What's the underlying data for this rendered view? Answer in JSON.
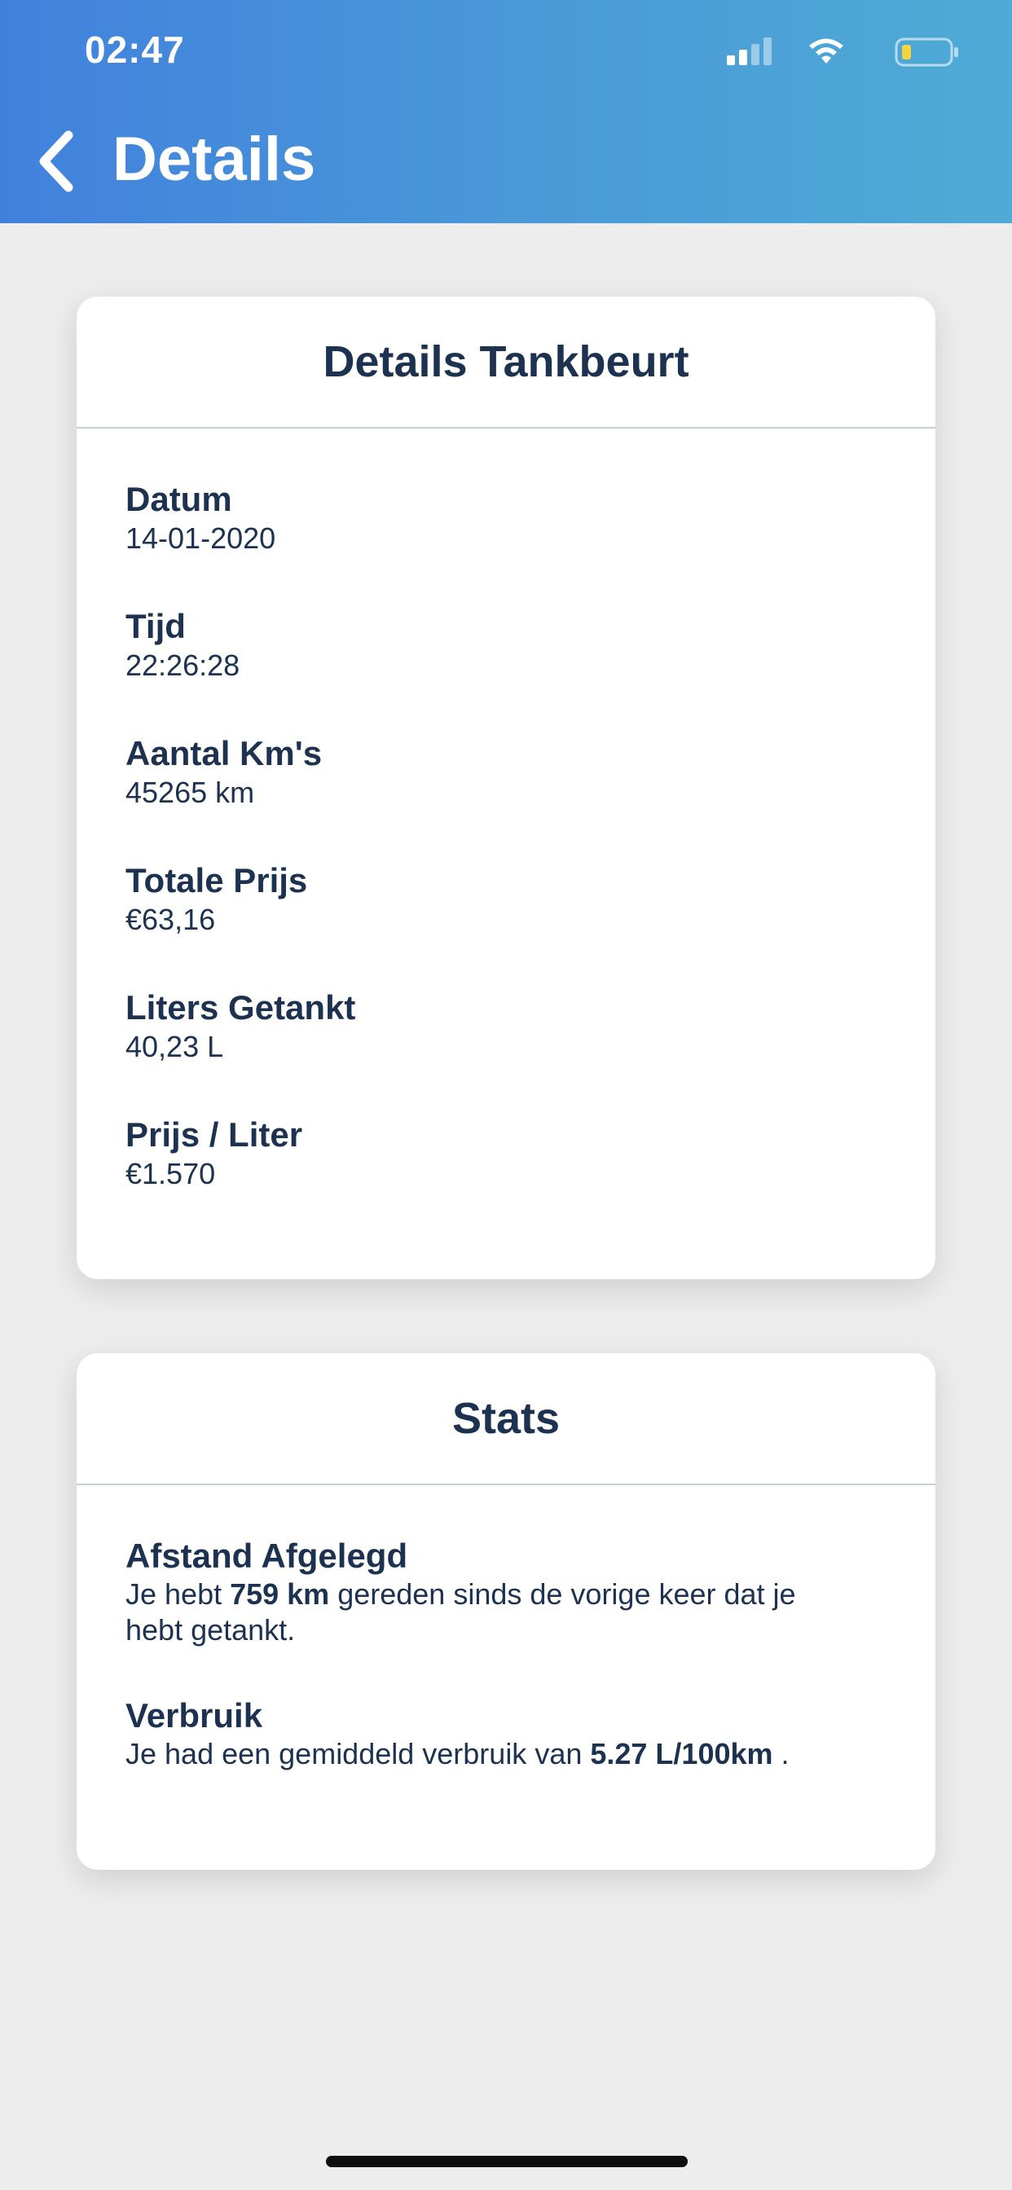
{
  "status_bar": {
    "time": "02:47",
    "icons": [
      "signal-icon",
      "wifi-icon",
      "battery-icon"
    ],
    "battery_color": "#f2d43c"
  },
  "nav": {
    "back_icon": "chevron-left-icon",
    "title": "Details"
  },
  "colors": {
    "header_gradient_start": "#4181dd",
    "header_gradient_end": "#4fabd6",
    "text_dark": "#1c3250",
    "background": "#ededed"
  },
  "details_card": {
    "title": "Details Tankbeurt",
    "fields": [
      {
        "label": "Datum",
        "value": "14-01-2020"
      },
      {
        "label": "Tijd",
        "value": "22:26:28"
      },
      {
        "label": "Aantal Km's",
        "value": "45265 km"
      },
      {
        "label": "Totale Prijs",
        "value": "€63,16"
      },
      {
        "label": "Liters Getankt",
        "value": "40,23 L"
      },
      {
        "label": "Prijs / Liter",
        "value": "€1.570"
      }
    ]
  },
  "stats_card": {
    "title": "Stats",
    "distance": {
      "label": "Afstand Afgelegd",
      "text_before": "Je hebt ",
      "highlight": "759 km",
      "text_after": " gereden sinds de vorige keer dat je hebt getankt."
    },
    "consumption": {
      "label": "Verbruik",
      "text_before": "Je had een gemiddeld verbruik van ",
      "highlight": "5.27 L/100km",
      "text_after": " ."
    }
  }
}
